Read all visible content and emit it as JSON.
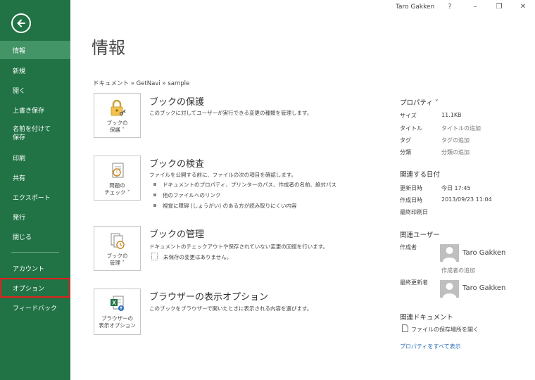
{
  "titlebar": {
    "username": "Taro Gakken",
    "help": "?",
    "minimize": "–",
    "restore": "❐",
    "close": "✕"
  },
  "sidebar": {
    "items": [
      {
        "label": "情報"
      },
      {
        "label": "新規"
      },
      {
        "label": "開く"
      },
      {
        "label": "上書き保存"
      },
      {
        "label": "名前を付けて\n保存"
      },
      {
        "label": "印刷"
      },
      {
        "label": "共有"
      },
      {
        "label": "エクスポート"
      },
      {
        "label": "発行"
      },
      {
        "label": "閉じる"
      },
      {
        "label": "アカウント"
      },
      {
        "label": "オプション"
      },
      {
        "label": "フィードバック"
      }
    ]
  },
  "main": {
    "title": "情報",
    "breadcrumb": "ドキュメント » GetNavi » sample",
    "sections": {
      "protect": {
        "button": "ブックの\n保護 ˅",
        "title": "ブックの保護",
        "desc": "このブックに対してユーザーが実行できる変更の種類を管理します。"
      },
      "inspect": {
        "button": "問題の\nチェック ˅",
        "title": "ブックの検査",
        "desc": "ファイルを公開する前に、ファイルの次の項目を確認します。",
        "bullets": [
          "ドキュメントのプロパティ、プリンターのパス、作成者の名前、絶対パス",
          "他のファイルへのリンク",
          "視覚に障碍 (しょうがい) のある方が読み取りにくい内容"
        ]
      },
      "manage": {
        "button": "ブックの\n管理 ˅",
        "title": "ブックの管理",
        "desc": "ドキュメントのチェックアウトや保存されていない変更の回復を行います。",
        "status": "未保存の変更はありません。"
      },
      "browser": {
        "button": "ブラウザーの\n表示オプション",
        "title": "ブラウザーの表示オプション",
        "desc": "このブックをブラウザーで開いたときに表示される内容を選びます。"
      }
    }
  },
  "properties": {
    "heading": "プロパティ ˅",
    "rows": [
      {
        "label": "サイズ",
        "value": "11.1KB"
      },
      {
        "label": "タイトル",
        "value": "タイトルの追加"
      },
      {
        "label": "タグ",
        "value": "タグの追加"
      },
      {
        "label": "分類",
        "value": "分類の追加"
      }
    ],
    "dates_heading": "関連する日付",
    "dates": [
      {
        "label": "更新日時",
        "value": "今日 17:45"
      },
      {
        "label": "作成日時",
        "value": "2013/09/23 11:04"
      },
      {
        "label": "最終印刷日",
        "value": ""
      }
    ],
    "people_heading": "関連ユーザー",
    "author_label": "作成者",
    "author_name": "Taro Gakken",
    "add_author": "作成者の追加",
    "modifier_label": "最終更新者",
    "modifier_name": "Taro Gakken",
    "docs_heading": "関連ドキュメント",
    "open_location": "ファイルの保存場所を開く",
    "show_all": "プロパティをすべて表示"
  },
  "colors": {
    "sidebar": "#217346",
    "sidebar_active": "#439467",
    "highlight": "#e0201e",
    "link": "#2a6ebb"
  }
}
